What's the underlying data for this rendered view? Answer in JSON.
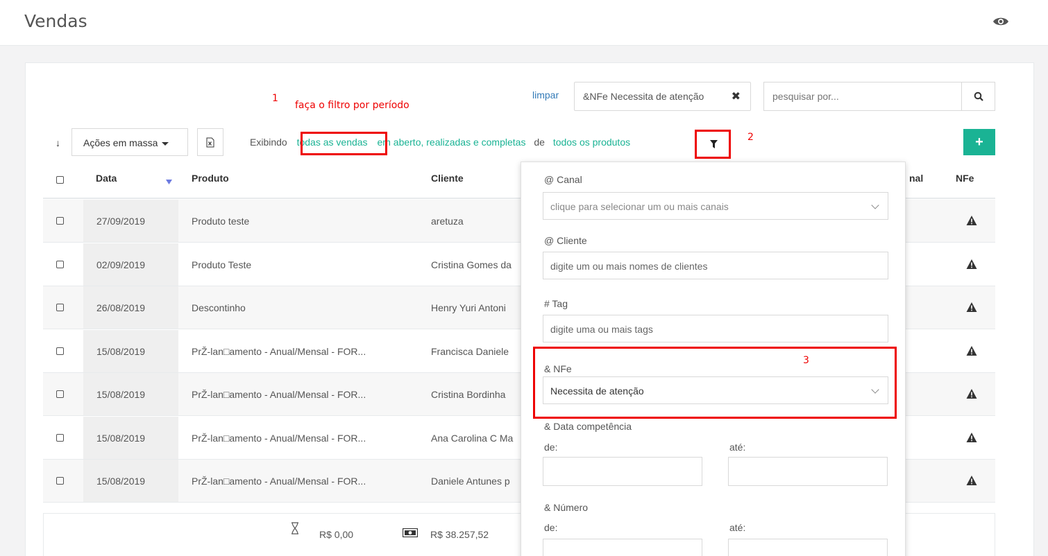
{
  "header": {
    "title": "Vendas",
    "eye_icon": "eye-icon"
  },
  "annotations": {
    "a1_num": "1",
    "a1_text": "faça o filtro por período",
    "a2": "2",
    "a3": "3",
    "color": "#ee0000"
  },
  "filters": {
    "clear_label": "limpar",
    "active_chip": "&NFe Necessita de atenção",
    "search_placeholder": "pesquisar por..."
  },
  "toolbar": {
    "bulk_actions_label": "Ações em massa",
    "showing_label": "Exibindo",
    "all_sales_link": "todas as vendas",
    "status_link": "em aberto, realizadas e completas",
    "of_label": "de",
    "products_link": "todos os produtos"
  },
  "table": {
    "columns": {
      "date": "Data",
      "product": "Produto",
      "client": "Cliente",
      "channel": "nal",
      "nfe": "NFe"
    },
    "rows": [
      {
        "date": "27/09/2019",
        "product": "Produto teste",
        "client": "aretuza"
      },
      {
        "date": "02/09/2019",
        "product": "Produto Teste",
        "client": "Cristina Gomes da"
      },
      {
        "date": "26/08/2019",
        "product": "Descontinho",
        "client": "Henry Yuri Antoni"
      },
      {
        "date": "15/08/2019",
        "product": "PrŽ-lan□amento - Anual/Mensal - FOR...",
        "client": "Francisca Daniele"
      },
      {
        "date": "15/08/2019",
        "product": "PrŽ-lan□amento - Anual/Mensal - FOR...",
        "client": "Cristina Bordinha"
      },
      {
        "date": "15/08/2019",
        "product": "PrŽ-lan□amento - Anual/Mensal - FOR...",
        "client": "Ana Carolina C Ma"
      },
      {
        "date": "15/08/2019",
        "product": "PrŽ-lan□amento - Anual/Mensal - FOR...",
        "client": "Daniele Antunes p"
      }
    ]
  },
  "totals": {
    "pending": "R$ 0,00",
    "received": "R$ 38.257,52"
  },
  "filter_panel": {
    "canal_label": "@ Canal",
    "canal_placeholder": "clique para selecionar um ou mais canais",
    "cliente_label": "@ Cliente",
    "cliente_placeholder": "digite um ou mais nomes de clientes",
    "tag_label": "# Tag",
    "tag_placeholder": "digite uma ou mais tags",
    "nfe_label": "& NFe",
    "nfe_value": "Necessita de atenção",
    "competencia_label": "& Data competência",
    "from_label": "de:",
    "to_label": "até:",
    "numero_label": "& Número"
  },
  "colors": {
    "accent": "#1ab394",
    "link": "#337ab7"
  }
}
